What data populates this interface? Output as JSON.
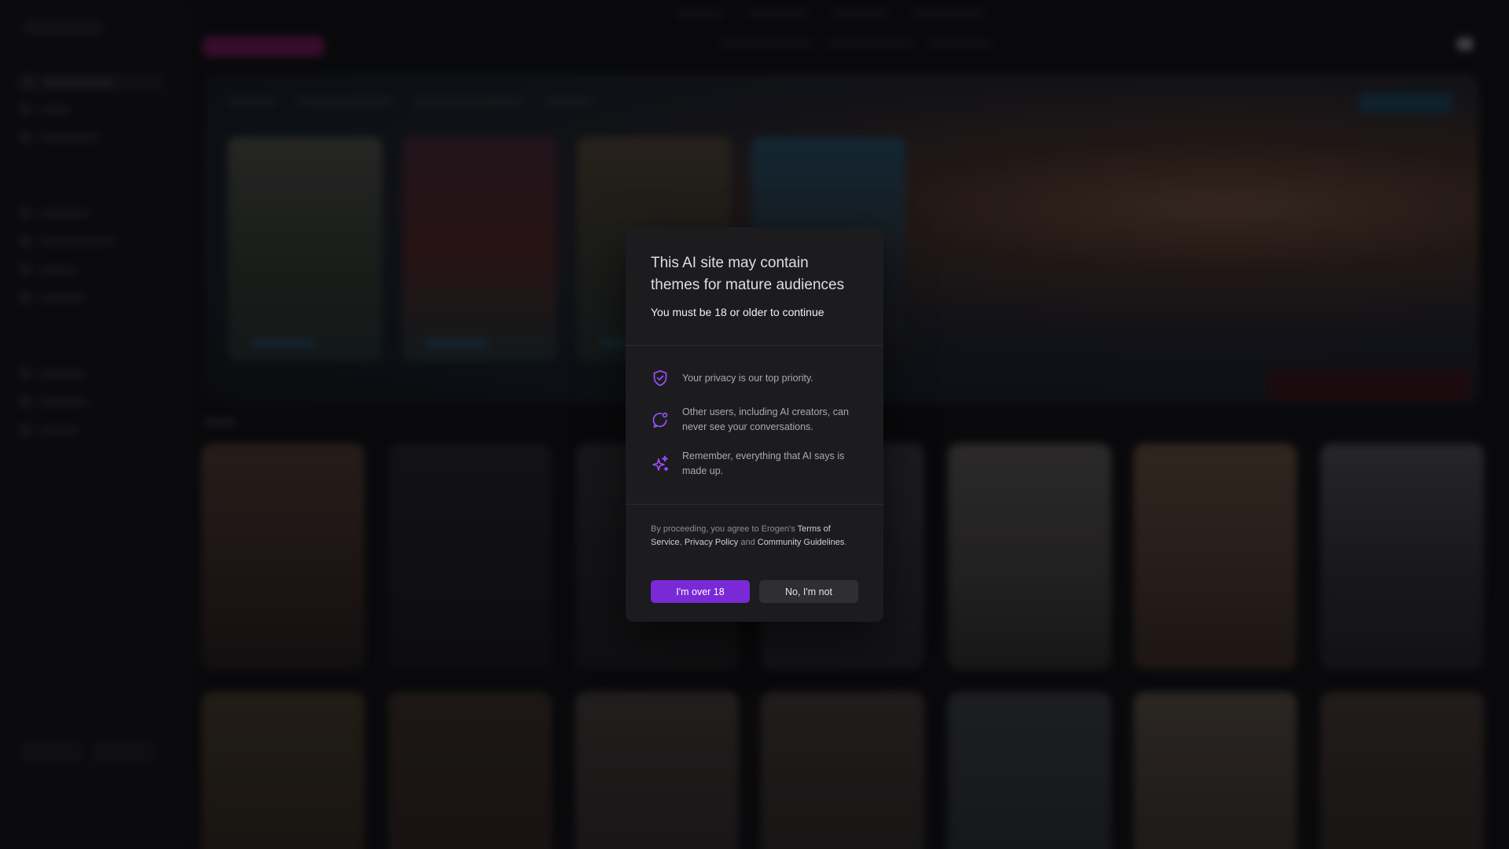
{
  "modal": {
    "title": "This AI site may contain themes for mature audiences",
    "subtitle": "You must be 18 or older to continue",
    "items": [
      {
        "icon": "shield-check-icon",
        "text": "Your privacy is our top priority."
      },
      {
        "icon": "chat-bubble-icon",
        "text": "Other users, including AI creators, can never see your conversations."
      },
      {
        "icon": "sparkles-icon",
        "text": "Remember, everything that AI says is made up."
      }
    ],
    "legal": {
      "prefix": "By proceeding, you agree to Erogen's ",
      "terms": "Terms of Service",
      "sep1": ", ",
      "privacy": "Privacy Policy",
      "sep2": " and ",
      "guidelines": "Community Guidelines",
      "suffix": "."
    },
    "confirm_label": "I'm over 18",
    "deny_label": "No, I'm not"
  },
  "colors": {
    "accent": "#7a29d6",
    "icon_purple": "#9b4dff",
    "modal_bg": "#1c1c1f",
    "create_button": "#a2177a"
  },
  "background": {
    "state": "blurred",
    "hero_cards": 4,
    "grid_cards_per_row": 7
  }
}
